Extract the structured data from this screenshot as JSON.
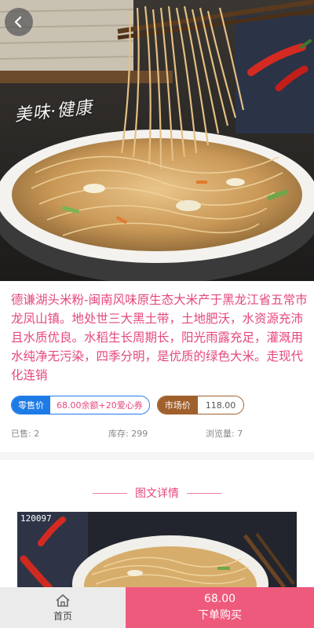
{
  "hero": {
    "image": "fried-rice-noodles-photo",
    "watermark": "美味·健康"
  },
  "product": {
    "description": "德谦湖头米粉-闽南风味原生态大米产于黑龙江省五常市龙凤山镇。地处世三大黑土带，土地肥沃，水资源充沛且水质优良。水稻生长周期长，阳光雨露充足，灌溉用水纯净无污染，四季分明，是优质的绿色大米。走现代化连销",
    "retail_label": "零售价",
    "retail_value": "68.00余额+20爱心券",
    "market_label": "市场价",
    "market_value": "118.00"
  },
  "stats": {
    "sold": "已售: 2",
    "stock": "库存: 299",
    "views": "浏览量: 7"
  },
  "detail": {
    "section_title": "图文详情",
    "image_label": "120097"
  },
  "bottom_bar": {
    "home_label": "首页",
    "buy_price": "68.00",
    "buy_label": "下单购买"
  },
  "colors": {
    "accent_pink": "#e5487a",
    "retail_blue": "#1e7be6",
    "market_brown": "#a0602c",
    "buy_button": "#ee5a7c"
  },
  "icons": {
    "back": "chevron-left-icon",
    "home": "home-icon"
  }
}
